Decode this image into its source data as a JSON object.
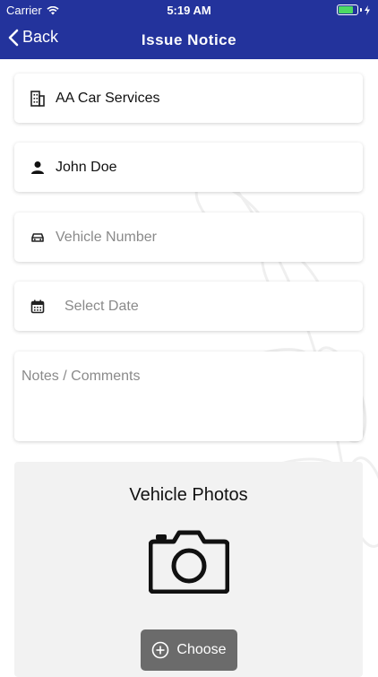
{
  "status_bar": {
    "carrier": "Carrier",
    "time": "5:19 AM"
  },
  "nav": {
    "back_label": "Back",
    "title": "Issue Notice"
  },
  "form": {
    "company": "AA Car Services",
    "name": "John Doe",
    "vehicle_number_placeholder": "Vehicle Number",
    "date_placeholder": "Select Date",
    "notes_placeholder": "Notes / Comments"
  },
  "photos": {
    "title": "Vehicle Photos",
    "choose_label": "Choose"
  },
  "colors": {
    "nav_bg": "#23339c",
    "battery": "#4cd964",
    "choose_bg": "#6b6b6b"
  },
  "icons": [
    "wifi-icon",
    "battery-icon",
    "back-chevron-icon",
    "building-icon",
    "person-icon",
    "car-icon",
    "calendar-icon",
    "camera-icon",
    "plus-circle-icon"
  ]
}
